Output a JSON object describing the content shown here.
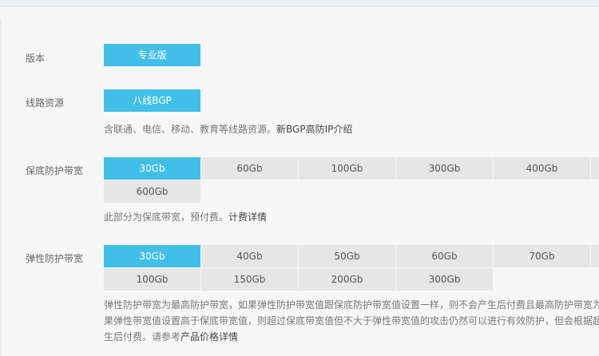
{
  "edition": {
    "label": "版本",
    "value": "专业版"
  },
  "line_resources": {
    "label": "线路资源",
    "value": "八线BGP",
    "hint_text": "含联通、电信、移动、教育等线路资源。",
    "hint_link": "新BGP高防IP介绍"
  },
  "base_protection": {
    "label": "保底防护带宽",
    "options": [
      "30Gb",
      "60Gb",
      "100Gb",
      "300Gb",
      "400Gb",
      "600Gb"
    ],
    "selected": "30Gb",
    "hint_text": "此部分为保底带宽，预付费。",
    "hint_link": "计费详情"
  },
  "elastic_protection": {
    "label": "弹性防护带宽",
    "options": [
      "30Gb",
      "40Gb",
      "50Gb",
      "60Gb",
      "70Gb",
      "100Gb",
      "150Gb",
      "200Gb",
      "300Gb"
    ],
    "selected": "30Gb",
    "desc_line1": "弹性防护带宽为最高防护带宽，如果弹性防护带宽值跟保底防护带宽值设置一样，则不会产生后付费且最高防护带宽为",
    "desc_line2": "果弹性带宽值设置高于保底带宽值，则超过保底带宽值但不大于弹性带宽值的攻击仍然可以进行有效防护，但会根据超",
    "desc_line3_text": "生后付费。请参考",
    "desc_line3_link": "产品价格详情"
  }
}
